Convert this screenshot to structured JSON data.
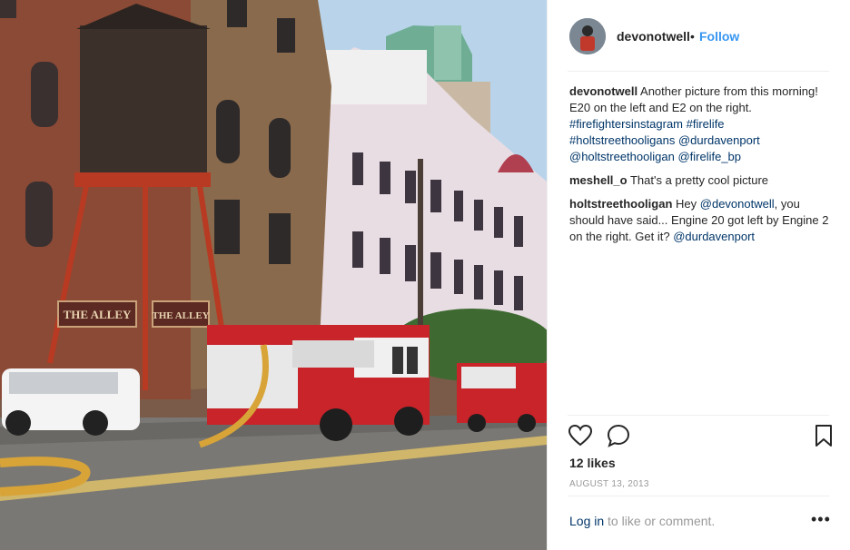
{
  "post": {
    "username": "devonotwell",
    "separator": "•",
    "follow_label": "Follow",
    "likes": "12 likes",
    "date": "AUGUST 13, 2013"
  },
  "photo": {
    "signs": [
      "THE ALLEY",
      "THE ALLEY"
    ]
  },
  "comments": [
    {
      "user": "devonotwell",
      "text": "Another picture from this morning! E20 on the left and E2 on the right.",
      "tags": [
        "#firefightersinstagram",
        "#firelife",
        "#holtstreethooligans",
        "@durdavenport",
        "@holtstreethooligan",
        "@firelife_bp"
      ]
    },
    {
      "user": "meshell_o",
      "text": "That's a pretty cool picture"
    },
    {
      "user": "holtstreethooligan",
      "text_before": "Hey",
      "mention": "@devonotwell",
      "text_after": ", you should have said... Engine 20 got left by Engine 2 on the right. Get it?",
      "mention2": "@durdavenport"
    }
  ],
  "footer": {
    "login_link": "Log in",
    "login_text": " to like or comment.",
    "more": "•••"
  },
  "icons": {
    "like": "heart-icon",
    "comment": "comment-icon",
    "save": "bookmark-icon",
    "more": "more-options-icon"
  }
}
